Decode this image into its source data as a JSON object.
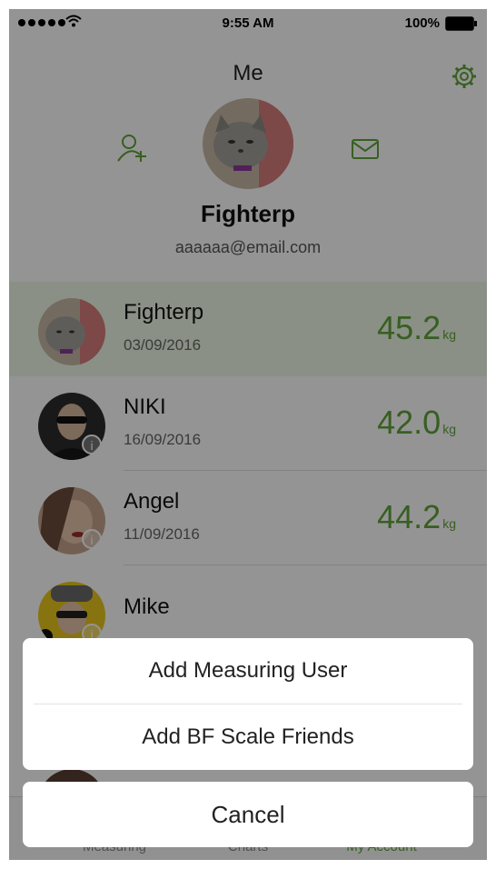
{
  "status_bar": {
    "time": "9:55 AM",
    "battery": "100%"
  },
  "header": {
    "title": "Me"
  },
  "profile": {
    "name": "Fighterp",
    "email": "aaaaaa@email.com"
  },
  "users": [
    {
      "name": "Fighterp",
      "date": "03/09/2016",
      "weight": "45.2",
      "unit": "kg"
    },
    {
      "name": "NIKI",
      "date": "16/09/2016",
      "weight": "42.0",
      "unit": "kg"
    },
    {
      "name": "Angel",
      "date": "11/09/2016",
      "weight": "44.2",
      "unit": "kg"
    },
    {
      "name": "Mike",
      "date": "",
      "weight": "",
      "unit": ""
    }
  ],
  "tabs": [
    {
      "label": "Measuring"
    },
    {
      "label": "Charts"
    },
    {
      "label": "My Account"
    }
  ],
  "action_sheet": {
    "options": [
      "Add Measuring User",
      "Add BF Scale Friends"
    ],
    "cancel": "Cancel"
  },
  "colors": {
    "accent": "#5fa43a",
    "overlay": "#000000"
  },
  "icons": [
    "signal-dots-icon",
    "wifi-icon",
    "battery-icon",
    "gear-icon",
    "add-user-icon",
    "mail-icon",
    "info-icon"
  ]
}
